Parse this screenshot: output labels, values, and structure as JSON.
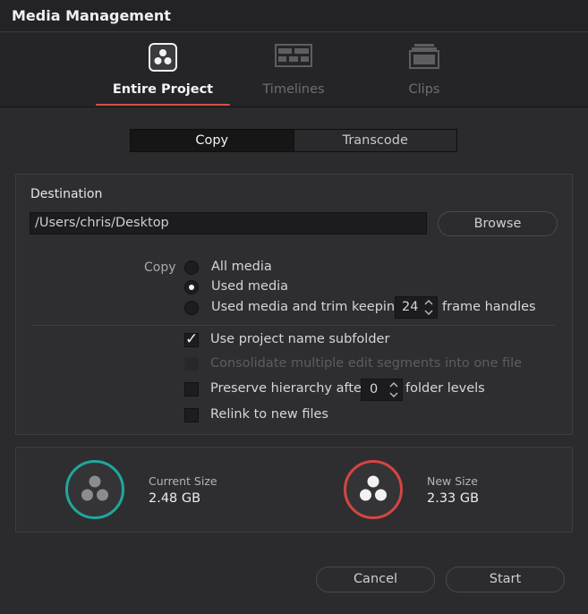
{
  "window": {
    "title": "Media Management"
  },
  "tabs": [
    {
      "label": "Entire Project",
      "icon": "resolve-logo-icon",
      "active": true
    },
    {
      "label": "Timelines",
      "icon": "timeline-icon",
      "active": false
    },
    {
      "label": "Clips",
      "icon": "clips-icon",
      "active": false
    }
  ],
  "mode": {
    "copy_label": "Copy",
    "transcode_label": "Transcode",
    "selected": "Copy"
  },
  "destination": {
    "label": "Destination",
    "path": "/Users/chris/Desktop",
    "browse_label": "Browse"
  },
  "copy": {
    "label": "Copy",
    "options": [
      "All media",
      "Used media",
      "Used media and trim keeping"
    ],
    "selected_index": 1,
    "handles_value": "24",
    "handles_suffix": "frame handles"
  },
  "checks": {
    "use_project_subfolder": {
      "label": "Use project name subfolder",
      "checked": true
    },
    "consolidate": {
      "label": "Consolidate multiple edit segments into one file",
      "checked": false,
      "enabled": false
    },
    "preserve": {
      "label": "Preserve hierarchy after",
      "value": "0",
      "suffix": "folder levels",
      "checked": false
    },
    "relink": {
      "label": "Relink to new files",
      "checked": false
    }
  },
  "sizes": {
    "current": {
      "label": "Current Size",
      "value": "2.48 GB",
      "ring_color": "#1fa89a"
    },
    "new": {
      "label": "New Size",
      "value": "2.33 GB",
      "ring_color": "#d64541"
    }
  },
  "buttons": {
    "cancel_label": "Cancel",
    "start_label": "Start"
  },
  "colors": {
    "accent": "#d4504a"
  }
}
